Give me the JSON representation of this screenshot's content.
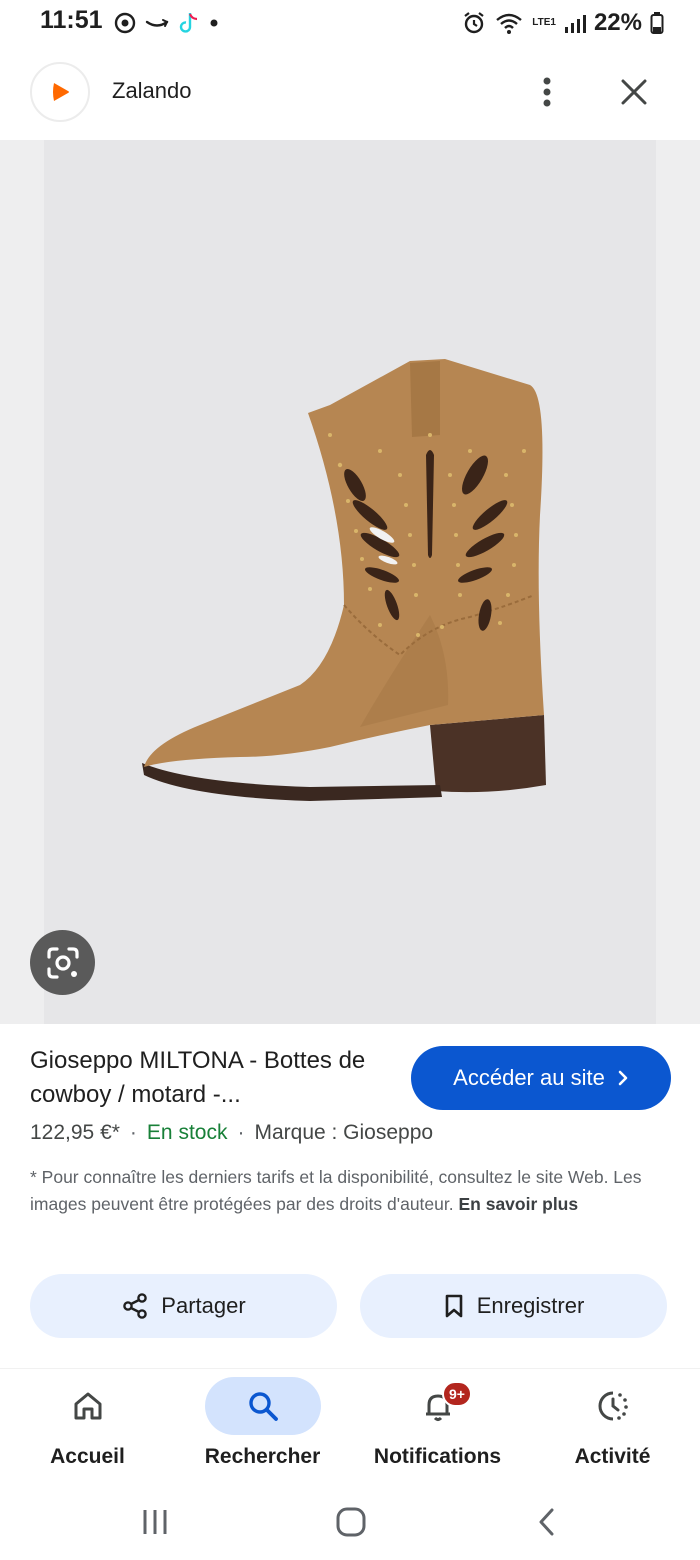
{
  "status_bar": {
    "time": "11:51",
    "battery": "22%",
    "network_label": "LTE1"
  },
  "header": {
    "site_name": "Zalando",
    "brand_color": "#ff6900"
  },
  "product": {
    "title": "Gioseppo MILTONA - Bottes de cowboy / motard -...",
    "price": "122,95 €*",
    "stock": "En stock",
    "brand": "Marque : Gioseppo",
    "visit_button": "Accéder au site",
    "disclaimer": "* Pour connaître les derniers tarifs et la disponibilité, consultez le site Web. Les images peuvent être protégées par des droits d'auteur.",
    "learn_more": "En savoir plus"
  },
  "actions": {
    "share": "Partager",
    "save": "Enregistrer"
  },
  "bottom_nav": {
    "items": [
      {
        "label": "Accueil",
        "icon": "home-icon",
        "active": false
      },
      {
        "label": "Rechercher",
        "icon": "search-icon",
        "active": true
      },
      {
        "label": "Notifications",
        "icon": "bell-icon",
        "active": false,
        "badge": "9+"
      },
      {
        "label": "Activité",
        "icon": "activity-icon",
        "active": false
      }
    ]
  },
  "colors": {
    "primary_button": "#0b57d0",
    "chip_background": "#e8f0fe",
    "active_nav": "#d3e3fd",
    "in_stock": "#188038",
    "badge": "#b3261e"
  }
}
